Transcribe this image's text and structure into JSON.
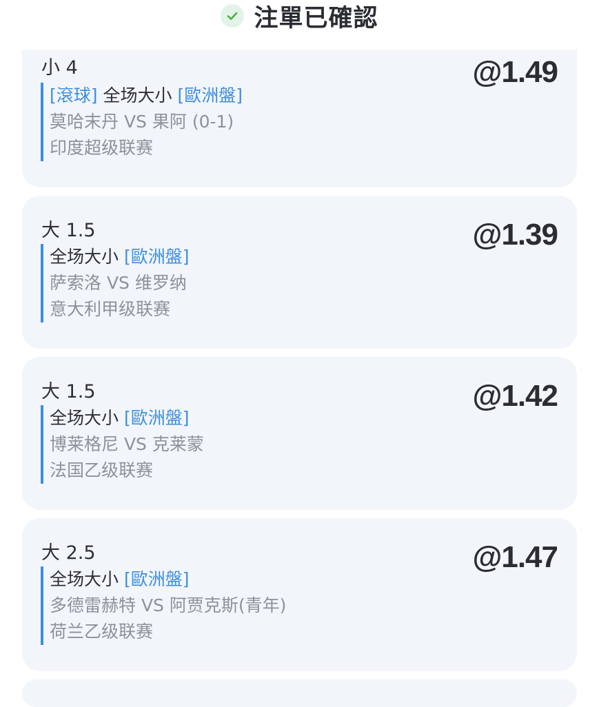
{
  "header": {
    "title": "注單已確認"
  },
  "bets": [
    {
      "selection": "小 4",
      "odds": "@1.49",
      "live_tag": "[滾球]",
      "market": "全场大小",
      "market_tag": "[歐洲盤]",
      "teams": "莫哈末丹 VS 果阿",
      "score": "(0-1)",
      "league": "印度超级联赛"
    },
    {
      "selection": "大 1.5",
      "odds": "@1.39",
      "market": "全场大小",
      "market_tag": "[歐洲盤]",
      "teams": "萨索洛 VS 维罗纳",
      "league": "意大利甲级联赛"
    },
    {
      "selection": "大 1.5",
      "odds": "@1.42",
      "market": "全场大小",
      "market_tag": "[歐洲盤]",
      "teams": "博莱格尼 VS 克莱蒙",
      "league": "法国乙级联赛"
    },
    {
      "selection": "大 2.5",
      "odds": "@1.47",
      "market": "全场大小",
      "market_tag": "[歐洲盤]",
      "teams": "多德雷赫特 VS 阿贾克斯(青年)",
      "league": "荷兰乙级联赛"
    }
  ],
  "colors": {
    "accent": "#3f8de0",
    "card_bg": "#f2f6fb",
    "success": "#4caf50"
  }
}
